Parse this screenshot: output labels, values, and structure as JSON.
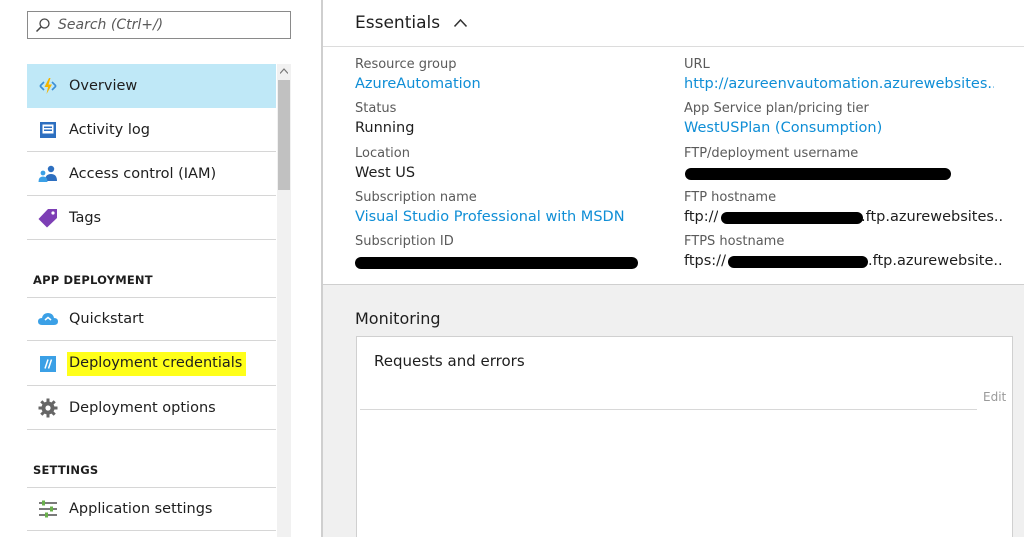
{
  "search": {
    "placeholder": "Search (Ctrl+/)"
  },
  "sidebar": {
    "items": [
      {
        "label": "Overview",
        "icon": "lightning-icon"
      },
      {
        "label": "Activity log",
        "icon": "activity-log-icon"
      },
      {
        "label": "Access control (IAM)",
        "icon": "users-icon"
      },
      {
        "label": "Tags",
        "icon": "tag-icon"
      }
    ],
    "sections": [
      {
        "title": "APP DEPLOYMENT",
        "items": [
          {
            "label": "Quickstart",
            "icon": "cloud-icon"
          },
          {
            "label": "Deployment credentials",
            "icon": "credentials-icon"
          },
          {
            "label": "Deployment options",
            "icon": "gear-icon"
          }
        ]
      },
      {
        "title": "SETTINGS",
        "items": [
          {
            "label": "Application settings",
            "icon": "sliders-icon"
          }
        ]
      }
    ]
  },
  "essentials": {
    "title": "Essentials",
    "left": [
      {
        "label": "Resource group",
        "value": "AzureAutomation"
      },
      {
        "label": "Status",
        "value": "Running"
      },
      {
        "label": "Location",
        "value": "West US"
      },
      {
        "label": "Subscription name",
        "value": "Visual Studio Professional with MSDN"
      },
      {
        "label": "Subscription ID",
        "value": ""
      }
    ],
    "right": [
      {
        "label": "URL",
        "value": "http://azureenvautomation.azurewebsites...."
      },
      {
        "label": "App Service plan/pricing tier",
        "value": "WestUSPlan (Consumption)"
      },
      {
        "label": "FTP/deployment username",
        "value": ""
      },
      {
        "label": "FTP hostname",
        "prefix": "ftp://",
        "suffix": ".ftp.azurewebsites..."
      },
      {
        "label": "FTPS hostname",
        "prefix": "ftps://",
        "suffix": ".ftp.azurewebsite..."
      }
    ]
  },
  "monitoring": {
    "title": "Monitoring",
    "card_title": "Requests and errors",
    "edit_label": "Edit"
  },
  "colors": {
    "accent_link": "#0f8ed6",
    "active_nav": "#bfe8f7",
    "highlight": "#ffff1a"
  }
}
